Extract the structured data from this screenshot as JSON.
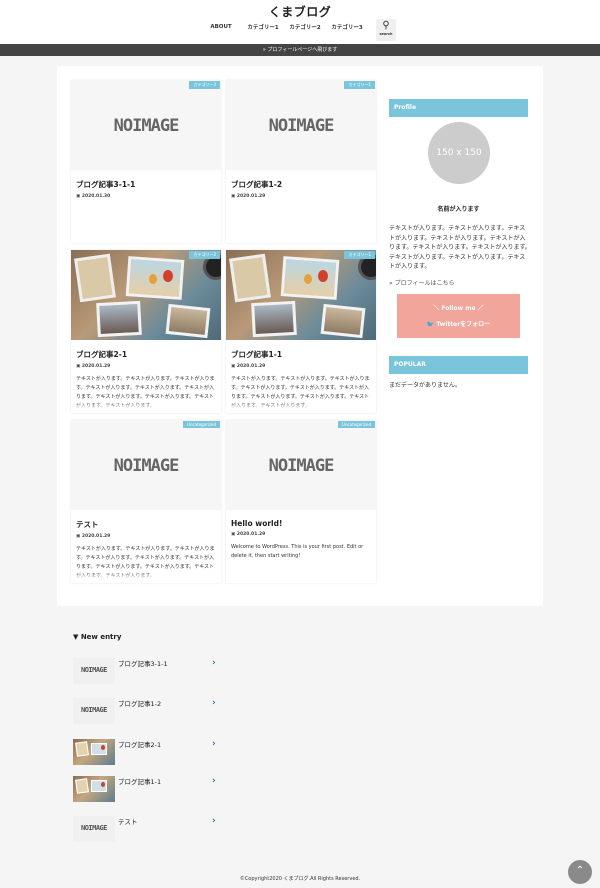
{
  "site": {
    "title": "くまブログ"
  },
  "nav": {
    "items": [
      "ABOUT",
      "カテゴリー1",
      "カテゴリー2",
      "カテゴリー3"
    ],
    "search_label": "search",
    "search_icon": "search-icon"
  },
  "profile_bar": {
    "text": "» プロフィールページへ飛びます"
  },
  "posts": [
    {
      "title": "ブログ記事3-1-1",
      "date": "2020.01.30",
      "category": "カテゴリー3",
      "image": "no-image",
      "excerpt": ""
    },
    {
      "title": "ブログ記事1-2",
      "date": "2020.01.29",
      "category": "カテゴリー1",
      "image": "no-image",
      "excerpt": ""
    },
    {
      "title": "ブログ記事2-1",
      "date": "2020.01.29",
      "category": "カテゴリー2",
      "image": "photo",
      "excerpt": "テキストが入ります。テキストが入ります。テキストが入ります。テキストが入ります。テキストが入ります。テキストが入ります。テキストが入ります。テキストが入ります。テキストが入ります。テキストが入ります。"
    },
    {
      "title": "ブログ記事1-1",
      "date": "2020.01.29",
      "category": "カテゴリー1",
      "image": "photo",
      "excerpt": "テキストが入ります。テキストが入ります。テキストが入ります。テキストが入ります。テキストが入ります。テキストが入ります。テキストが入ります。テキストが入ります。テキストが入ります。テキストが入ります。"
    },
    {
      "title": "テスト",
      "date": "2020.01.29",
      "category": "Uncategorized",
      "image": "no-image",
      "excerpt": "テキストが入ります。テキストが入ります。テキストが入ります。テキストが入ります。テキストが入ります。テキストが入ります。テキストが入ります。テキストが入ります。テキストが入ります。テキストが入ります。"
    },
    {
      "title": "Hello world!",
      "date": "2020.01.29",
      "category": "Uncategorized",
      "image": "no-image",
      "excerpt": "Welcome to WordPress. This is your first post. Edit or delete it, then start writing!"
    }
  ],
  "no_image_text": "NOIMAGE",
  "sidebar": {
    "profile_title": "Profile",
    "avatar_text": "150 x 150",
    "name": "名前が入ります",
    "text": "テキストが入ります。テキストが入ります。テキストが入ります。テキストが入ります。テキストが入ります。テキストが入ります。テキストが入ります。テキストが入ります。テキストが入ります。テキストが入ります。",
    "profile_link": "» プロフィールはこちら",
    "follow_label": "＼ Follow me ／",
    "twitter_label": "Twitterをフォロー",
    "popular_title": "POPULAR",
    "no_data": "まだデータがありません。"
  },
  "new_entry": {
    "title": "▼ New entry",
    "items": [
      {
        "title": "ブログ記事3-1-1",
        "image": "no-image"
      },
      {
        "title": "ブログ記事1-2",
        "image": "no-image"
      },
      {
        "title": "ブログ記事2-1",
        "image": "photo"
      },
      {
        "title": "ブログ記事1-1",
        "image": "photo"
      },
      {
        "title": "テスト",
        "image": "no-image"
      }
    ],
    "chevron": "›"
  },
  "footer": {
    "copyright": "©Copyright2020 くまブログ.All Rights Reserved."
  },
  "back_to_top": {
    "glyph": "⌃"
  },
  "colors": {
    "accent": "#7ac5db",
    "follow": "#f2a59b",
    "bar": "#444444",
    "chevron": "#2c6da0"
  }
}
